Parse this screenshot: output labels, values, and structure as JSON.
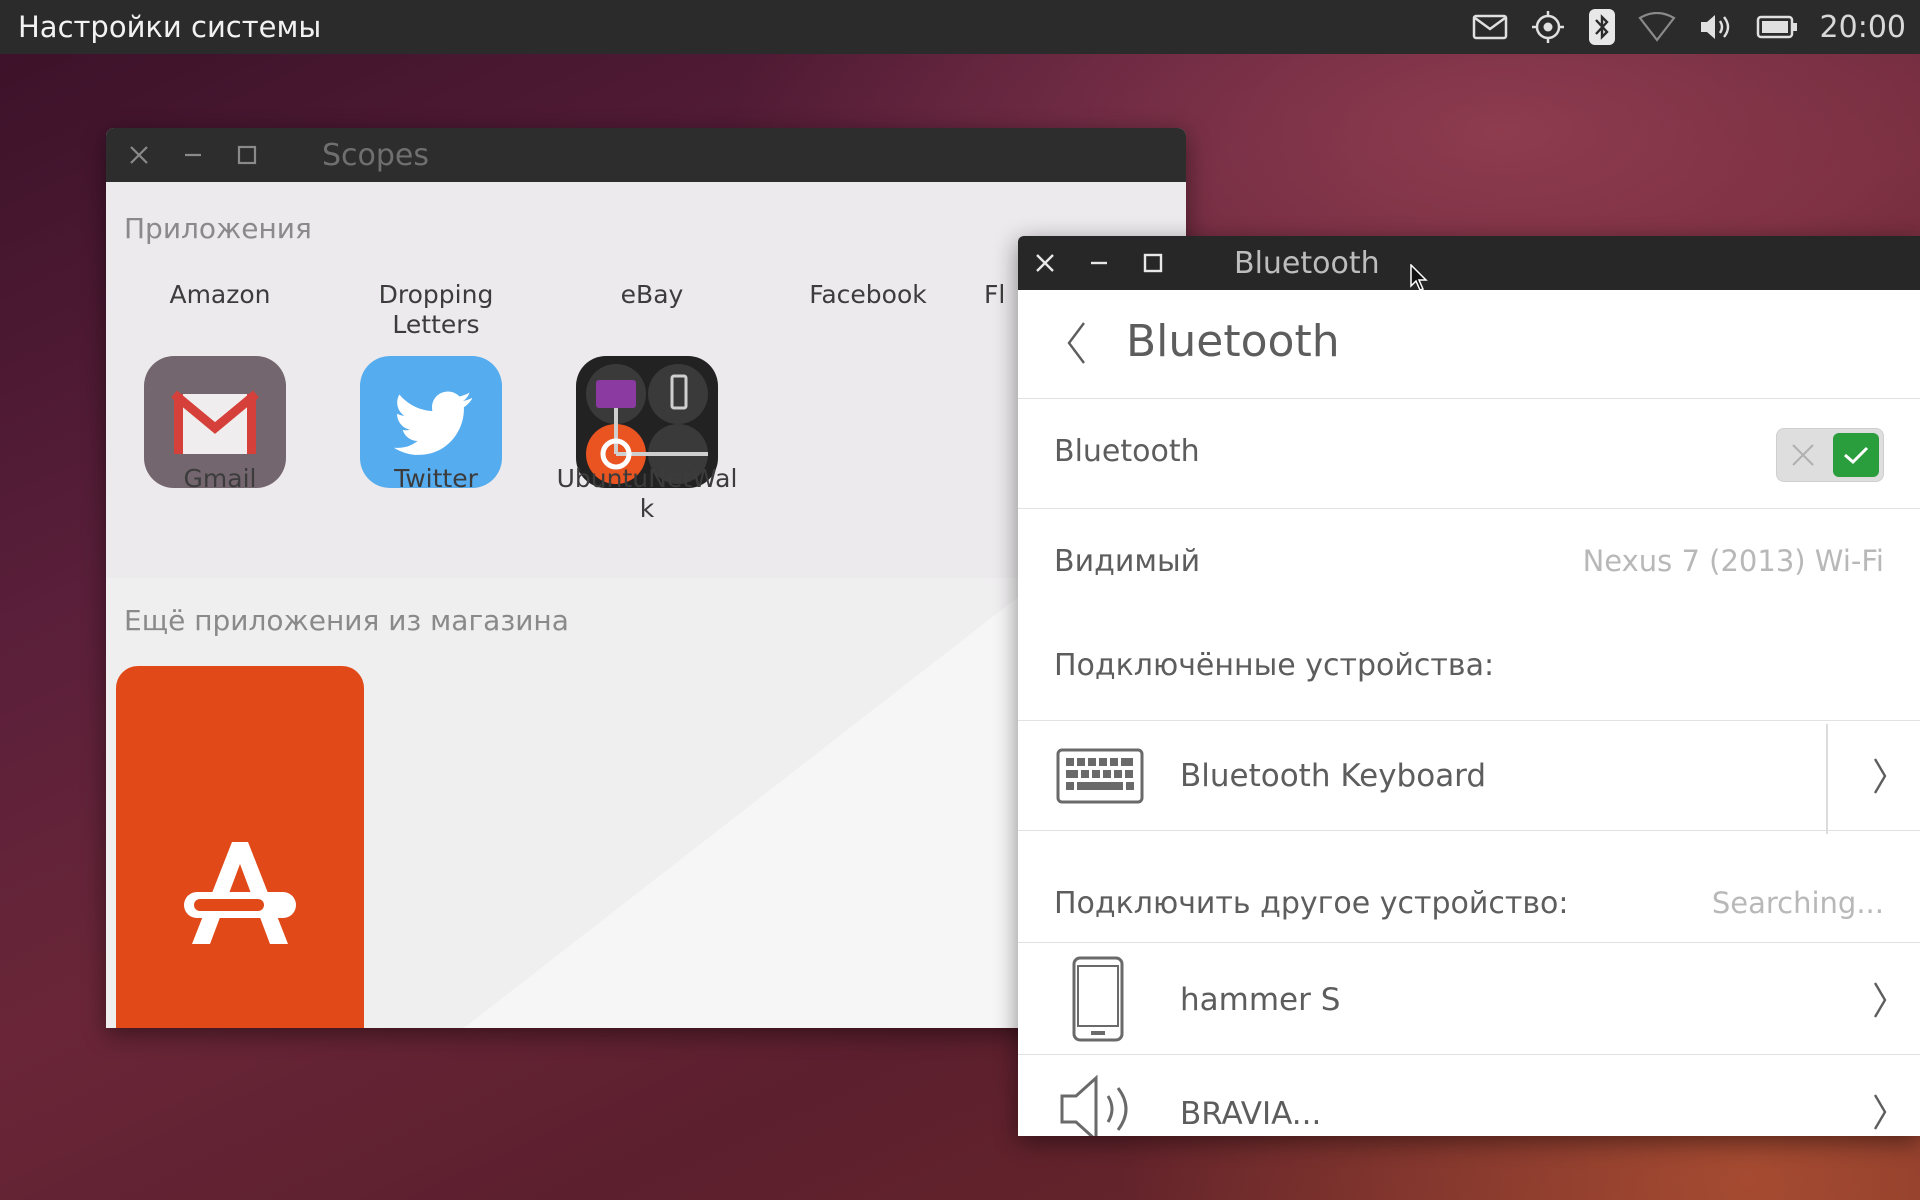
{
  "topbar": {
    "title": "Настройки системы",
    "time": "20:00",
    "indicators": [
      "mail-icon",
      "location-icon",
      "bluetooth-icon",
      "wifi-icon",
      "volume-icon",
      "battery-icon"
    ]
  },
  "scopes_window": {
    "title": "Scopes",
    "section_apps": "Приложения",
    "top_labels": [
      "Amazon",
      "Dropping Letters",
      "eBay",
      "Facebook",
      "Fl"
    ],
    "apps": [
      {
        "label": "Gmail",
        "icon": "gmail-icon",
        "color": "#74666e"
      },
      {
        "label": "Twitter",
        "icon": "twitter-icon",
        "color": "#55acee"
      },
      {
        "label": "UbuntuNetWalk",
        "icon": "ubuntu-netwalk-icon",
        "color": "#222222"
      }
    ],
    "section_store": "Ещё приложения из магазина",
    "store_card_color": "#e14a18"
  },
  "bluetooth_window": {
    "title": "Bluetooth",
    "header": "Bluetooth",
    "toggle_label": "Bluetooth",
    "toggle_on": true,
    "visible_label": "Видимый",
    "visible_value": "Nexus 7 (2013) Wi-Fi",
    "connected_header": "Подключённые устройства:",
    "connected_devices": [
      {
        "name": "Bluetooth Keyboard",
        "icon": "keyboard-icon"
      }
    ],
    "connect_other_header": "Подключить другое устройство:",
    "searching": "Searching...",
    "other_devices": [
      {
        "name": "hammer S",
        "icon": "phone-icon"
      },
      {
        "name": "BRAVIA...",
        "icon": "speaker-icon"
      }
    ]
  },
  "colors": {
    "accent_toggle": "#2a9d3c",
    "panel": "#2b2b2b"
  }
}
